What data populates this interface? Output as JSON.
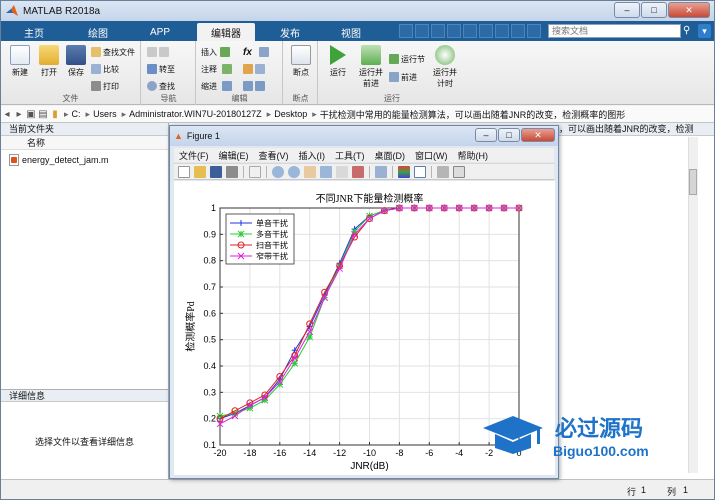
{
  "app": {
    "title": "MATLAB R2018a"
  },
  "tabs": [
    {
      "label": "主页",
      "active": false
    },
    {
      "label": "绘图",
      "active": false
    },
    {
      "label": "APP",
      "active": false
    },
    {
      "label": "编辑器",
      "active": true
    },
    {
      "label": "发布",
      "active": false
    },
    {
      "label": "视图",
      "active": false
    }
  ],
  "search": {
    "placeholder": "搜索文档"
  },
  "ribbon": {
    "file": {
      "label": "文件",
      "new": "新建",
      "open": "打开",
      "save": "保存",
      "find_files": "查找文件",
      "compare": "比较",
      "print": "打印"
    },
    "navigate": {
      "label": "导航",
      "goto": "转至",
      "find": "查找"
    },
    "edit": {
      "label": "编辑",
      "insert": "插入",
      "comment": "注释",
      "indent": "缩进",
      "fx": "fx"
    },
    "breakpoints": {
      "label": "断点",
      "breakpoint": "断点"
    },
    "run": {
      "label": "运行",
      "run": "运行",
      "run_advance": "运行并\n前进",
      "run_section": "运行节",
      "advance": "前进",
      "run_time": "运行并\n计时"
    }
  },
  "path": [
    "C:",
    "Users",
    "Administrator.WIN7U-20180127Z",
    "Desktop",
    "干扰检测中常用的能量检测算法，可以画出随着JNR的改变，检测概率的图形"
  ],
  "left_pane": {
    "header": "当前文件夹",
    "column": "名称",
    "files": [
      "energy_detect_jam.m"
    ],
    "detail_header": "详细信息",
    "detail_text": "选择文件以查看详细信息"
  },
  "right_pane": {
    "header": "，可以画出随着JNR的改变，检测"
  },
  "status": {
    "row_label": "行",
    "row": "1",
    "col_label": "列",
    "col": "1"
  },
  "figure": {
    "title": "Figure 1",
    "menu": [
      "文件(F)",
      "编辑(E)",
      "查看(V)",
      "插入(I)",
      "工具(T)",
      "桌面(D)",
      "窗口(W)",
      "帮助(H)"
    ]
  },
  "chart_data": {
    "type": "line",
    "title": "不同JNR下能量检测概率",
    "xlabel": "JNR(dB)",
    "ylabel": "检测概率Pd",
    "xlim": [
      -20,
      0
    ],
    "ylim": [
      0.1,
      1
    ],
    "xticks": [
      -20,
      -18,
      -16,
      -14,
      -12,
      -10,
      -8,
      -6,
      -4,
      -2,
      0
    ],
    "yticks": [
      0.1,
      0.2,
      0.3,
      0.4,
      0.5,
      0.6,
      0.7,
      0.8,
      0.9,
      1
    ],
    "grid": true,
    "legend_position": "top-left",
    "x": [
      -20,
      -19,
      -18,
      -17,
      -16,
      -15,
      -14,
      -13,
      -12,
      -11,
      -10,
      -9,
      -8,
      -7,
      -6,
      -5,
      -4,
      -3,
      -2,
      -1,
      0
    ],
    "series": [
      {
        "name": "单音干扰",
        "color": "#2233dd",
        "marker": "plus",
        "values": [
          0.2,
          0.22,
          0.25,
          0.28,
          0.35,
          0.46,
          0.55,
          0.67,
          0.79,
          0.92,
          0.97,
          0.99,
          1,
          1,
          1,
          1,
          1,
          1,
          1,
          1,
          1
        ]
      },
      {
        "name": "多音干扰",
        "color": "#22cc33",
        "marker": "star",
        "values": [
          0.21,
          0.22,
          0.24,
          0.27,
          0.33,
          0.41,
          0.51,
          0.66,
          0.78,
          0.91,
          0.97,
          0.99,
          1,
          1,
          1,
          1,
          1,
          1,
          1,
          1,
          1
        ]
      },
      {
        "name": "扫音干扰",
        "color": "#dd2222",
        "marker": "circle",
        "values": [
          0.2,
          0.23,
          0.26,
          0.29,
          0.36,
          0.44,
          0.56,
          0.68,
          0.78,
          0.89,
          0.96,
          0.99,
          1,
          1,
          1,
          1,
          1,
          1,
          1,
          1,
          1
        ]
      },
      {
        "name": "窄带干扰",
        "color": "#dd22dd",
        "marker": "x",
        "values": [
          0.18,
          0.21,
          0.25,
          0.28,
          0.34,
          0.43,
          0.53,
          0.66,
          0.77,
          0.9,
          0.96,
          0.99,
          1,
          1,
          1,
          1,
          1,
          1,
          1,
          1,
          1
        ]
      }
    ]
  },
  "watermark": {
    "text": "必过源码",
    "url": "Biguo100.com"
  }
}
